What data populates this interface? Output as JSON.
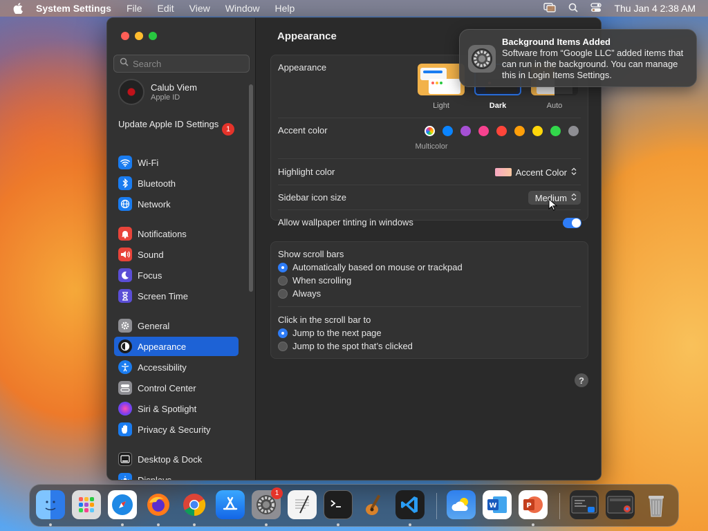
{
  "menubar": {
    "app_name": "System Settings",
    "menus": [
      "File",
      "Edit",
      "View",
      "Window",
      "Help"
    ],
    "clock": "Thu Jan 4  2:38 AM"
  },
  "sidebar": {
    "search_placeholder": "Search",
    "profile": {
      "name": "Calub Viem",
      "subtitle": "Apple ID"
    },
    "update": {
      "label": "Update Apple ID Settings",
      "badge": "1"
    },
    "items": [
      {
        "label": "Wi-Fi",
        "icon": "wifi-icon",
        "color": "#1a7cf0"
      },
      {
        "label": "Bluetooth",
        "icon": "bluetooth-icon",
        "color": "#1a7cf0"
      },
      {
        "label": "Network",
        "icon": "globe-icon",
        "color": "#1a7cf0"
      },
      {
        "label": "Notifications",
        "icon": "bell-icon",
        "color": "#e8443a"
      },
      {
        "label": "Sound",
        "icon": "speaker-icon",
        "color": "#e8443a"
      },
      {
        "label": "Focus",
        "icon": "moon-icon",
        "color": "#5b4ed6"
      },
      {
        "label": "Screen Time",
        "icon": "hourglass-icon",
        "color": "#5b4ed6"
      },
      {
        "label": "General",
        "icon": "gear-icon",
        "color": "#8e8e93"
      },
      {
        "label": "Appearance",
        "icon": "appearance-icon",
        "color": "#1c1c1c"
      },
      {
        "label": "Accessibility",
        "icon": "accessibility-icon",
        "color": "#1a7cf0"
      },
      {
        "label": "Control Center",
        "icon": "control-center-icon",
        "color": "#8e8e93"
      },
      {
        "label": "Siri & Spotlight",
        "icon": "siri-icon",
        "color": "#b043d6"
      },
      {
        "label": "Privacy & Security",
        "icon": "hand-icon",
        "color": "#1a7cf0"
      },
      {
        "label": "Desktop & Dock",
        "icon": "dock-icon",
        "color": "#1c1c1c"
      },
      {
        "label": "Displays",
        "icon": "display-icon",
        "color": "#1a7cf0"
      }
    ],
    "selected": "Appearance"
  },
  "content": {
    "title": "Appearance",
    "appearance": {
      "label": "Appearance",
      "options": [
        "Light",
        "Dark",
        "Auto"
      ],
      "selected": "Dark"
    },
    "accent": {
      "label": "Accent color",
      "selected_name": "Multicolor",
      "colors": [
        "#ffffff",
        "#0a84ff",
        "#a550d4",
        "#f7428f",
        "#ff453a",
        "#ff9f0a",
        "#ffd60a",
        "#32d74b",
        "#8e8e93"
      ]
    },
    "highlight": {
      "label": "Highlight color",
      "value": "Accent Color"
    },
    "sidebar_icon_size": {
      "label": "Sidebar icon size",
      "value": "Medium"
    },
    "wallpaper_tinting": {
      "label": "Allow wallpaper tinting in windows",
      "on": true
    },
    "scroll_bars": {
      "label": "Show scroll bars",
      "options": [
        "Automatically based on mouse or trackpad",
        "When scrolling",
        "Always"
      ],
      "selected": 0
    },
    "click_scroll": {
      "label": "Click in the scroll bar to",
      "options": [
        "Jump to the next page",
        "Jump to the spot that’s clicked"
      ],
      "selected": 0
    },
    "help": "?"
  },
  "notification": {
    "title": "Background Items Added",
    "body": "Software from “Google LLC” added items that can run in the background. You can manage this in Login Items Settings."
  },
  "dock": {
    "settings_badge": "1"
  }
}
